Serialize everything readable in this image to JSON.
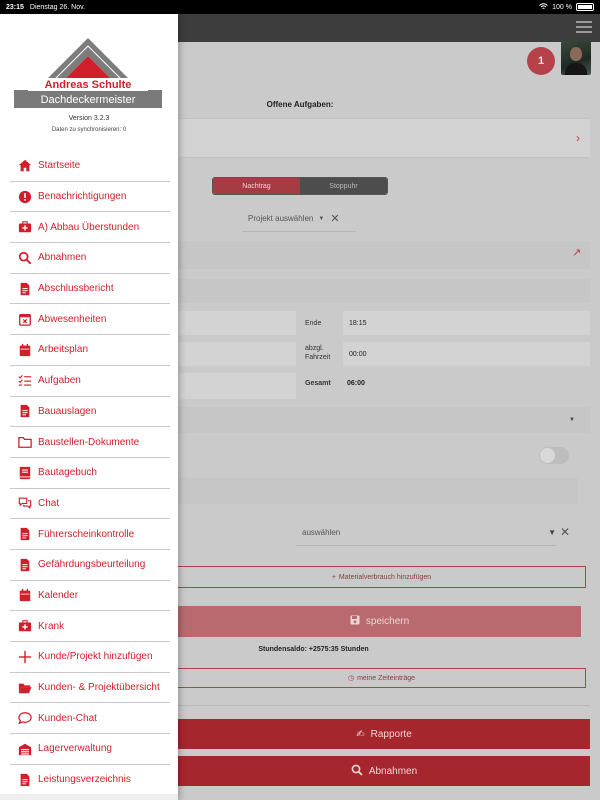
{
  "status_bar": {
    "time": "23:15",
    "date": "Dienstag 26. Nov.",
    "battery": "100 %"
  },
  "header": {
    "badge_count": "1"
  },
  "tasks": {
    "title": "Offene Aufgaben:"
  },
  "mode": {
    "tabs": [
      "Nachtrag",
      "Stoppuhr"
    ],
    "active": "Nachtrag"
  },
  "project": {
    "placeholder": "Projekt auswählen"
  },
  "time_fields": {
    "end_label": "Ende",
    "end_value": "18:15",
    "travel_label": "abzgl. Fahrzeit",
    "travel_value": "00:00",
    "total_label": "Gesamt",
    "total_value": "06:00"
  },
  "material": {
    "select_placeholder": "auswählen",
    "add_label": "Materialverbrauch hinzufügen"
  },
  "actions": {
    "save_label": "speichern",
    "balance": "Stundensaldo: +2575:35 Stunden",
    "my_entries_label": "meine Zeiteinträge",
    "rapporte_label": "Rapporte",
    "abnahmen_label": "Abnahmen"
  },
  "drawer": {
    "logo_name": "Andreas Schulte",
    "logo_title": "Dachdeckermeister",
    "version": "Version 3.2.3",
    "sync": "Daten zu synchronisieren: 0",
    "items": [
      {
        "label": "Startseite",
        "icon": "home-icon"
      },
      {
        "label": "Benachrichtigungen",
        "icon": "alert-icon"
      },
      {
        "label": "A) Abbau Überstunden",
        "icon": "first-aid-icon"
      },
      {
        "label": "Abnahmen",
        "icon": "search-icon"
      },
      {
        "label": "Abschlussbericht",
        "icon": "document-icon"
      },
      {
        "label": "Abwesenheiten",
        "icon": "calendar-x-icon"
      },
      {
        "label": "Arbeitsplan",
        "icon": "calendar-icon"
      },
      {
        "label": "Aufgaben",
        "icon": "checklist-icon"
      },
      {
        "label": "Bauauslagen",
        "icon": "document-icon"
      },
      {
        "label": "Baustellen-Dokumente",
        "icon": "folder-icon"
      },
      {
        "label": "Bautagebuch",
        "icon": "book-icon"
      },
      {
        "label": "Chat",
        "icon": "chat-icon"
      },
      {
        "label": "Führerscheinkontrolle",
        "icon": "document-icon"
      },
      {
        "label": "Gefährdungsbeurteilung",
        "icon": "document-icon"
      },
      {
        "label": "Kalender",
        "icon": "calendar-icon"
      },
      {
        "label": "Krank",
        "icon": "first-aid-icon"
      },
      {
        "label": "Kunde/Projekt hinzufügen",
        "icon": "plus-icon"
      },
      {
        "label": "Kunden- & Projektübersicht",
        "icon": "folder-open-icon"
      },
      {
        "label": "Kunden-Chat",
        "icon": "chat-bubble-icon"
      },
      {
        "label": "Lagerverwaltung",
        "icon": "warehouse-icon"
      },
      {
        "label": "Leistungsverzeichnis",
        "icon": "document-icon"
      }
    ]
  },
  "colors": {
    "accent": "#d01f2b",
    "dim_accent": "#a6262e",
    "overlay": "#cacaca"
  }
}
